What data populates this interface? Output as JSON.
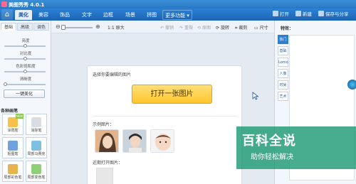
{
  "window": {
    "title": "美图秀秀 4.0.1"
  },
  "tabs": [
    {
      "label": "美化",
      "active": true
    },
    {
      "label": "美容"
    },
    {
      "label": "饰品"
    },
    {
      "label": "文字"
    },
    {
      "label": "边框"
    },
    {
      "label": "场景"
    },
    {
      "label": "拼图"
    },
    {
      "label": "更多功能 ▾"
    }
  ],
  "header_actions": {
    "open": "打开",
    "new": "新建",
    "save_share": "保存与分享"
  },
  "left_panel": {
    "tabs": [
      "基础",
      "高级",
      "调色"
    ],
    "sliders": [
      {
        "label": "亮度",
        "value": 0.5
      },
      {
        "label": "对比度",
        "value": 0.5
      },
      {
        "label": "色彩饱和度",
        "value": 0.5
      },
      {
        "label": "清晰度",
        "value": 0.0
      }
    ],
    "one_click": "一键美化",
    "section_title": "各种画笔",
    "tools": [
      {
        "label": "涂鸦笔",
        "badge": "NEW"
      },
      {
        "label": "消除笔"
      },
      {
        "label": "抠图笔"
      },
      {
        "label": "局部马赛克"
      },
      {
        "label": "局部彩色笔"
      },
      {
        "label": "局部变色笔"
      }
    ]
  },
  "canvas_toolbar": {
    "zoom_actual": "1:1 原大",
    "undo": "撤销",
    "redo": "重做",
    "reset": "原图",
    "rotate": "旋转",
    "crop": "裁剪",
    "size": "尺寸"
  },
  "canvas": {
    "prompt": "选择你要编辑的图片",
    "open_button": "打开一张图片",
    "samples_label": "示例图片：",
    "recent_label": "近期打开图片："
  },
  "right_panel": {
    "title": "特效：",
    "tabs": [
      "热门",
      "基础",
      "Lomo",
      "人像",
      "时尚",
      "艺术"
    ]
  },
  "watermark": {
    "big": "百科全说",
    "small": "助你轻松解决"
  },
  "colors": {
    "brand_blue": "#2b82d6",
    "open_button": "#ffc62a",
    "watermark": "#1a9670"
  }
}
